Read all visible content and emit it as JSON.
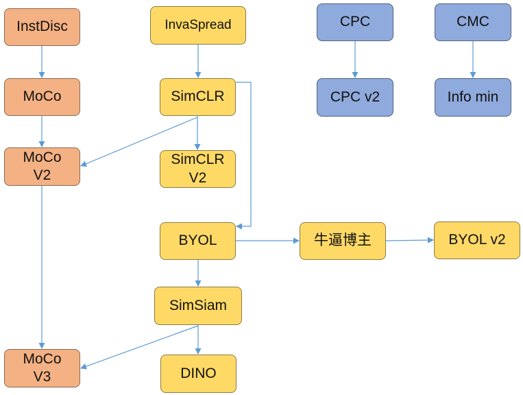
{
  "colors": {
    "moco_family": "#f4b183",
    "simclr_byol_family": "#ffd966",
    "cpc_cmc_family": "#8faadc",
    "arrow": "#5b9bd5"
  },
  "nodes": {
    "instdisc": "InstDisc",
    "moco": "MoCo",
    "moco_v2": "MoCo\nV2",
    "moco_v3": "MoCo\nV3",
    "invaspread": "InvaSpread",
    "simclr": "SimCLR",
    "simclr_v2": "SimCLR\nV2",
    "byol": "BYOL",
    "simsiam": "SimSiam",
    "dino": "DINO",
    "niubi_blogger": "牛逼博主",
    "byol_v2": "BYOL v2",
    "cpc": "CPC",
    "cpc_v2": "CPC v2",
    "cmc": "CMC",
    "info_min": "Info min"
  },
  "edges": [
    {
      "from": "instdisc",
      "to": "moco"
    },
    {
      "from": "moco",
      "to": "moco_v2"
    },
    {
      "from": "moco_v2",
      "to": "moco_v3"
    },
    {
      "from": "invaspread",
      "to": "simclr"
    },
    {
      "from": "simclr",
      "to": "simclr_v2"
    },
    {
      "from": "simclr",
      "to": "moco_v2"
    },
    {
      "from": "simclr",
      "to": "byol"
    },
    {
      "from": "byol",
      "to": "simsiam"
    },
    {
      "from": "byol",
      "to": "niubi_blogger"
    },
    {
      "from": "niubi_blogger",
      "to": "byol_v2"
    },
    {
      "from": "simsiam",
      "to": "dino"
    },
    {
      "from": "simsiam",
      "to": "moco_v3"
    },
    {
      "from": "cpc",
      "to": "cpc_v2"
    },
    {
      "from": "cmc",
      "to": "info_min"
    }
  ]
}
